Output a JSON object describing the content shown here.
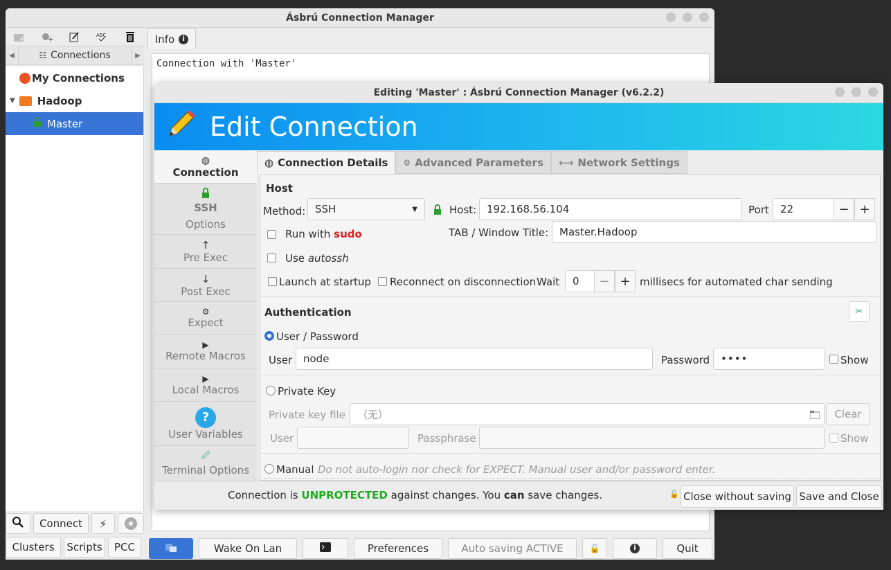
{
  "main_window": {
    "title": "Ásbrú Connection Manager",
    "connections_tab": "Connections",
    "tree": {
      "my_connections": "My Connections",
      "group": "Hadoop",
      "selected": "Master"
    },
    "info_tab": "Info",
    "info_text": "Connection with 'Master'",
    "bottom_left": {
      "connect": "Connect",
      "clusters": "Clusters",
      "scripts": "Scripts",
      "pcc": "PCC"
    },
    "bottom": {
      "wake_on_lan": "Wake On Lan",
      "preferences": "Preferences",
      "auto_saving": "Auto saving ACTIVE",
      "quit": "Quit"
    }
  },
  "dialog": {
    "title": "Editing 'Master' : Ásbrú Connection Manager (v6.2.2)",
    "banner": "Edit Connection",
    "side": {
      "connection": "Connection",
      "ssh": "SSH",
      "options": "Options",
      "pre_exec": "Pre Exec",
      "post_exec": "Post Exec",
      "expect": "Expect",
      "remote_macros": "Remote Macros",
      "local_macros": "Local Macros",
      "user_variables": "User Variables",
      "terminal_options": "Terminal Options"
    },
    "tabs": {
      "details": "Connection Details",
      "advanced": "Advanced Parameters",
      "network": "Network Settings"
    },
    "host": {
      "section": "Host",
      "method_label": "Method:",
      "method_value": "SSH",
      "host_label": "Host:",
      "host_value": "192.168.56.104",
      "port_label": "Port",
      "port_value": "22",
      "run_with": "Run with",
      "sudo": "sudo",
      "tab_title_label": "TAB / Window Title:",
      "tab_title_value": "Master.Hadoop",
      "use": "Use",
      "autossh": "autossh",
      "launch_at_startup": "Launch at startup",
      "reconnect": "Reconnect on disconnection",
      "wait": "Wait",
      "wait_value": "0",
      "wait_suffix": "millisecs for automated char sending"
    },
    "auth": {
      "section": "Authentication",
      "user_password": "User / Password",
      "user_label": "User",
      "user_value": "node",
      "password_label": "Password",
      "password_value": "••••",
      "show": "Show",
      "private_key": "Private Key",
      "private_key_file": "Private key file",
      "private_key_value": "（无）",
      "clear": "Clear",
      "pk_user": "User",
      "passphrase": "Passphrase",
      "pk_show": "Show",
      "manual": "Manual",
      "manual_desc": "Do not auto-login nor check for EXPECT. Manual user and/or password enter."
    },
    "status": {
      "prefix": "Connection is",
      "state": "UNPROTECTED",
      "middle": "against changes. You",
      "can": "can",
      "suffix": "save changes."
    },
    "close_without_saving": "Close without saving",
    "save_and_close": "Save and Close"
  }
}
